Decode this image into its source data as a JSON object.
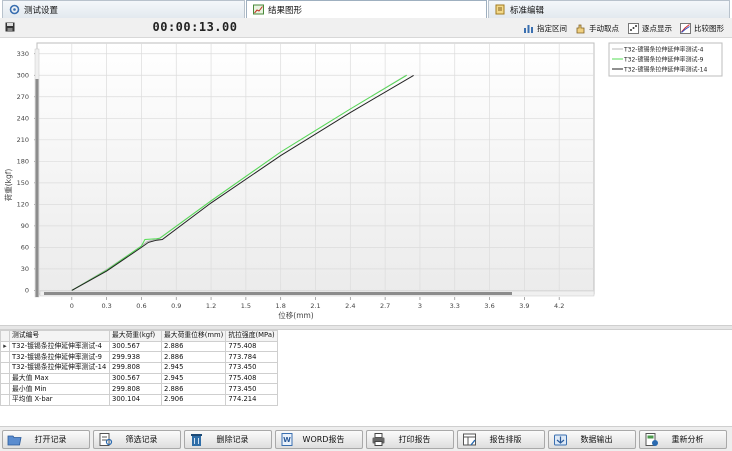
{
  "tabs": [
    {
      "label": "测试设置",
      "icon": "test-settings-icon",
      "active": false
    },
    {
      "label": "结果图形",
      "icon": "result-chart-icon",
      "active": true
    },
    {
      "label": "标准编辑",
      "icon": "standard-edit-icon",
      "active": false
    }
  ],
  "toolbar": {
    "timer": "00:00:13.00",
    "buttons": [
      {
        "label": "指定区间",
        "icon": "bar-chart-icon"
      },
      {
        "label": "手动取点",
        "icon": "hand-pick-icon"
      },
      {
        "label": "逐点显示",
        "icon": "point-display-icon"
      },
      {
        "label": "比较图形",
        "icon": "compare-chart-icon"
      }
    ]
  },
  "chart_data": {
    "type": "line",
    "xlabel": "位移(mm)",
    "ylabel": "荷重(kgf)",
    "xlim": [
      -0.3,
      4.5
    ],
    "ylim": [
      -5,
      345
    ],
    "xticks": [
      "0",
      "0.3",
      "0.6",
      "0.9",
      "1.2",
      "1.5",
      "1.8",
      "2.1",
      "2.4",
      "2.7",
      "3",
      "3.3",
      "3.6",
      "3.9",
      "4.2"
    ],
    "yticks": [
      "0",
      "30",
      "60",
      "90",
      "120",
      "150",
      "180",
      "210",
      "240",
      "270",
      "300",
      "330"
    ],
    "legend_position": "top-right",
    "grid": true,
    "series": [
      {
        "name": "T32-镀锡条拉伸延伸率测试-4",
        "color": "#b8b8b8",
        "x": [
          0,
          0.3,
          0.6,
          0.65,
          0.72,
          0.75,
          1.2,
          1.8,
          2.4,
          2.886
        ],
        "y": [
          0,
          29,
          62,
          68,
          71,
          72,
          125,
          193,
          253,
          300.567
        ]
      },
      {
        "name": "T32-镀锡条拉伸延伸率测试-9",
        "color": "#55dd55",
        "x": [
          0,
          0.3,
          0.6,
          0.63,
          0.73,
          0.76,
          1.2,
          1.8,
          2.4,
          2.886
        ],
        "y": [
          0,
          28,
          62,
          71,
          72,
          73,
          125,
          193,
          253,
          299.938
        ]
      },
      {
        "name": "T32-镀锡条拉伸延伸率测试-14",
        "color": "#222222",
        "x": [
          0,
          0.3,
          0.6,
          0.66,
          0.73,
          0.78,
          1.2,
          1.8,
          2.4,
          2.945
        ],
        "y": [
          0,
          27,
          60,
          67,
          70,
          71,
          122,
          188,
          248,
          299.808
        ]
      }
    ]
  },
  "table": {
    "headers": [
      "测试编号",
      "最大荷重(kgf)",
      "最大荷重位移(mm)",
      "抗拉强度(MPa)"
    ],
    "rows": [
      {
        "marker": "▸",
        "cells": [
          "T32-镀锡条拉伸延伸率测试-4",
          "300.567",
          "2.886",
          "775.408"
        ]
      },
      {
        "marker": "",
        "cells": [
          "T32-镀锡条拉伸延伸率测试-9",
          "299.938",
          "2.886",
          "773.784"
        ]
      },
      {
        "marker": "",
        "cells": [
          "T32-镀锡条拉伸延伸率测试-14",
          "299.808",
          "2.945",
          "773.450"
        ]
      },
      {
        "marker": "",
        "cells": [
          "最大值 Max",
          "300.567",
          "2.945",
          "775.408"
        ]
      },
      {
        "marker": "",
        "cells": [
          "最小值 Min",
          "299.808",
          "2.886",
          "773.450"
        ]
      },
      {
        "marker": "",
        "cells": [
          "平均值 X-bar",
          "300.104",
          "2.906",
          "774.214"
        ]
      }
    ]
  },
  "bottom_buttons": [
    {
      "label": "打开记录",
      "icon": "open-record-icon"
    },
    {
      "label": "筛选记录",
      "icon": "filter-record-icon"
    },
    {
      "label": "删除记录",
      "icon": "delete-record-icon"
    },
    {
      "label": "WORD报告",
      "icon": "word-report-icon"
    },
    {
      "label": "打印报告",
      "icon": "print-report-icon"
    },
    {
      "label": "报告排版",
      "icon": "report-layout-icon"
    },
    {
      "label": "数据输出",
      "icon": "data-export-icon"
    },
    {
      "label": "重新分析",
      "icon": "reanalyze-icon"
    }
  ]
}
